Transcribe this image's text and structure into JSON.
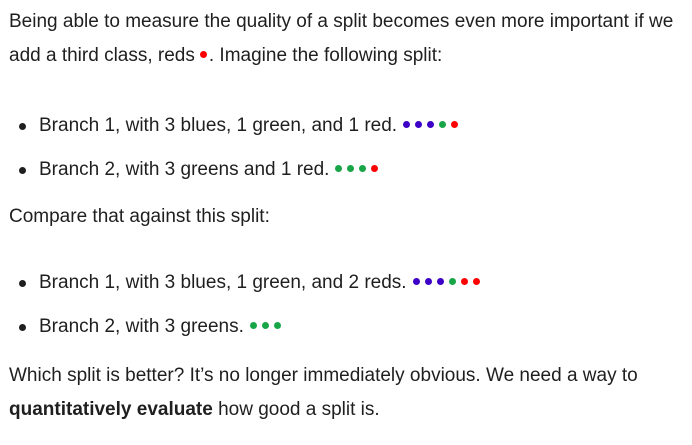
{
  "colors": {
    "blue": "#3d00c7",
    "green": "#18a547",
    "red": "#ff0000",
    "text": "#1f1f1f"
  },
  "intro": {
    "text_before_dot": "Being able to measure the quality of a split becomes even more important if we add a third class, reds",
    "dot_color": "red",
    "text_after_dot": ". Imagine the following split:"
  },
  "split_a": [
    {
      "text": "Branch 1, with 3 blues, 1 green, and 1 red.",
      "dots": [
        "blue",
        "blue",
        "blue",
        "green",
        "red"
      ]
    },
    {
      "text": "Branch 2, with 3 greens and 1 red.",
      "dots": [
        "green",
        "green",
        "green",
        "red"
      ]
    }
  ],
  "compare": {
    "text": "Compare that against this split:"
  },
  "split_b": [
    {
      "text": "Branch 1, with 3 blues, 1 green, and 2 reds.",
      "dots": [
        "blue",
        "blue",
        "blue",
        "green",
        "red",
        "red"
      ]
    },
    {
      "text": "Branch 2, with 3 greens.",
      "dots": [
        "green",
        "green",
        "green"
      ]
    }
  ],
  "conclusion": {
    "text_before_bold": "Which split is better? It’s no longer immediately obvious. We need a way to ",
    "bold_text": "quantitatively evaluate",
    "text_after_bold": " how good a split is."
  }
}
